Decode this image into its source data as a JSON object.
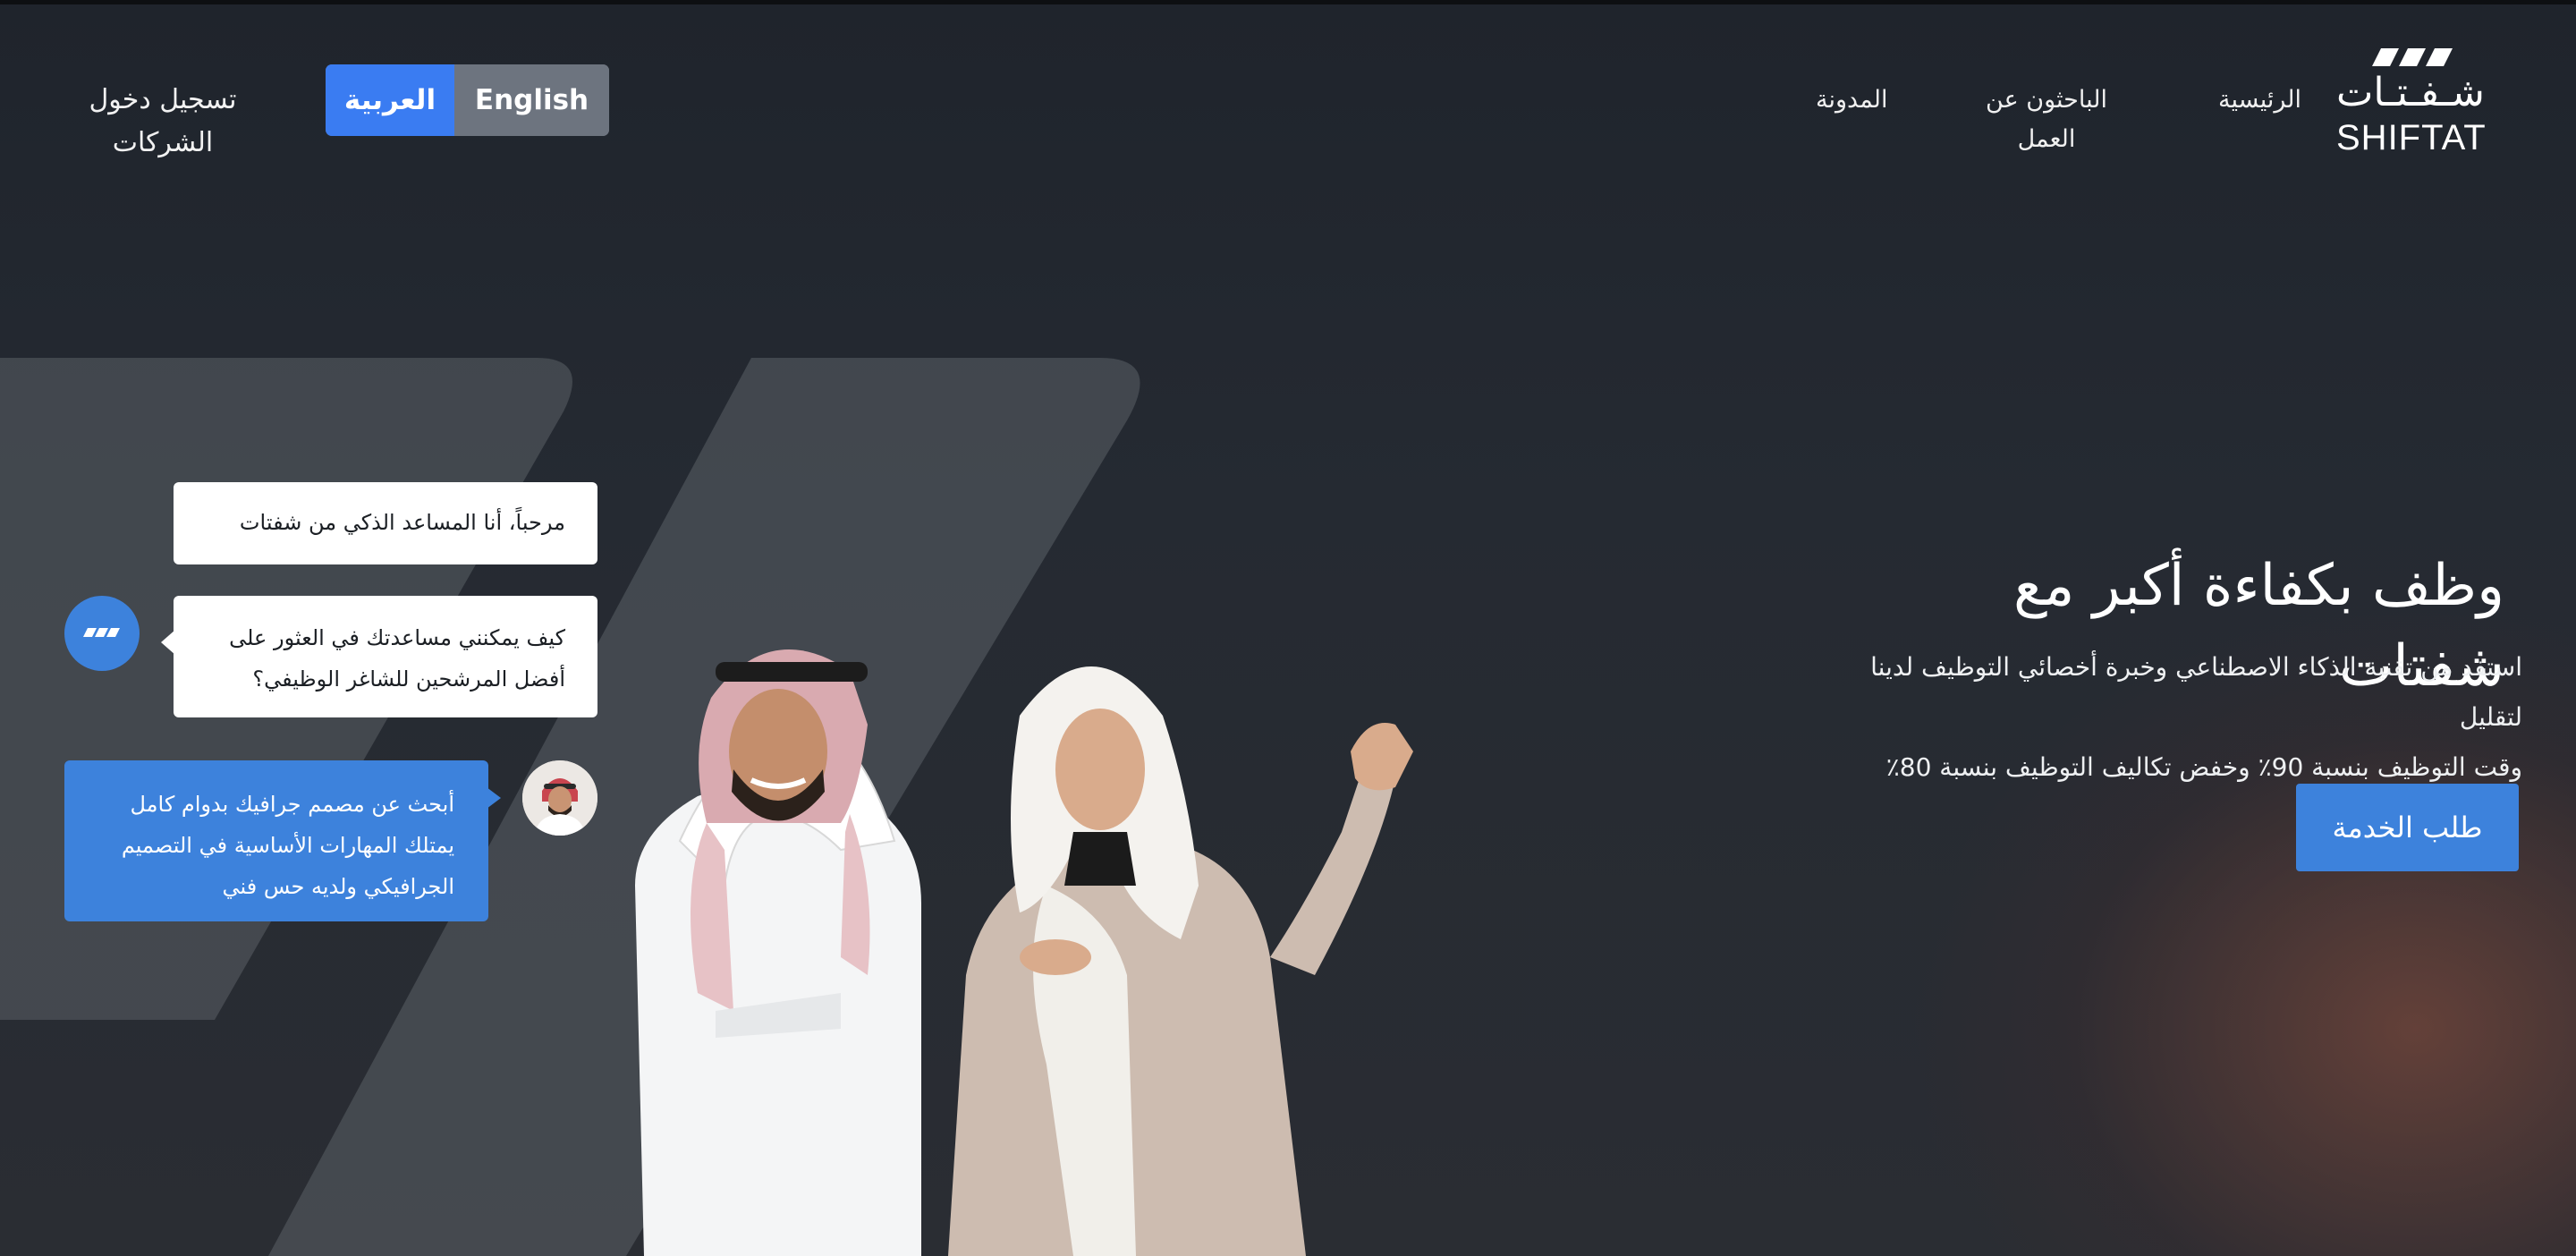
{
  "brand": {
    "logo_arabic": "شـفـتـات",
    "logo_english": "SHIFTAT"
  },
  "nav": {
    "home": "الرئيسية",
    "job_seekers": "الباحثون عن العمل",
    "blog": "المدونة"
  },
  "language_toggle": {
    "arabic": "العربية",
    "english": "English",
    "active": "العربية"
  },
  "company_login": "تسجيل دخول الشركات",
  "hero": {
    "title": "وظف بكفاءة أكبر مع شفتات",
    "subtitle_line1": "استفد من تقنية الذكاء الاصطناعي وخبرة أخصائي التوظيف لدينا لتقليل",
    "subtitle_line2": "وقت التوظيف بنسبة 90٪ وخفض تكاليف التوظيف بنسبة 80٪",
    "cta": "طلب الخدمة"
  },
  "chat": {
    "greeting": "مرحباً، أنا المساعد الذكي من شفتات",
    "question_line1": "كيف يمكنني مساعدتك في العثور على",
    "question_line2": "أفضل المرشحين للشاغر الوظيفي؟",
    "reply_line1": "أبحث عن مصمم جرافيك بدوام كامل",
    "reply_line2": "يمتلك المهارات الأساسية في التصميم",
    "reply_line3": "الجرافيكي ولديه حس فني"
  },
  "colors": {
    "accent_blue": "#3d82dc",
    "toggle_active": "#3a7cf2",
    "toggle_inactive": "#6d747f",
    "background_dark": "#23272e",
    "glow_warm": "#6e443a"
  },
  "icons": {
    "bot_avatar": "shiftat-logo-icon",
    "user_avatar": "user-photo-avatar"
  }
}
